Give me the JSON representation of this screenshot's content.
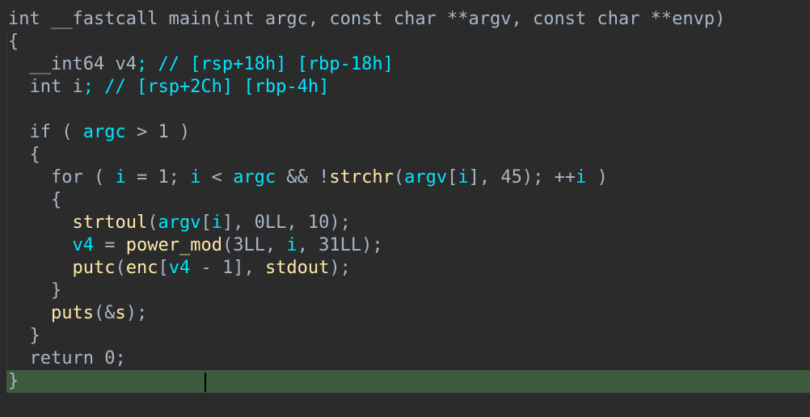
{
  "colors": {
    "background": "#2b2b2b",
    "current_line_highlight": "#3e5b3d",
    "default_text": "#a9b7c6",
    "variable": "#00e5ff",
    "function": "#ffe9a6"
  },
  "current_line": 16,
  "lines": [
    [
      {
        "t": "int __fastcall main(int argc, const char **argv, const char **envp)",
        "c": "pl"
      }
    ],
    [
      {
        "t": "{",
        "c": "pl"
      }
    ],
    [
      {
        "t": "  __int64 ",
        "c": "kw"
      },
      {
        "t": "v4",
        "c": "kw"
      },
      {
        "t": "; // [rsp+18h] [rbp-18h]",
        "c": "var"
      }
    ],
    [
      {
        "t": "  int ",
        "c": "kw"
      },
      {
        "t": "i",
        "c": "kw"
      },
      {
        "t": "; // [rsp+2Ch] [rbp-4h]",
        "c": "var"
      }
    ],
    [
      {
        "t": "",
        "c": "pl"
      }
    ],
    [
      {
        "t": "  if ( ",
        "c": "kw"
      },
      {
        "t": "argc",
        "c": "var"
      },
      {
        "t": " > 1 )",
        "c": "pl"
      }
    ],
    [
      {
        "t": "  {",
        "c": "pl"
      }
    ],
    [
      {
        "t": "    for ( ",
        "c": "kw"
      },
      {
        "t": "i",
        "c": "var"
      },
      {
        "t": " = 1; ",
        "c": "pl"
      },
      {
        "t": "i",
        "c": "var"
      },
      {
        "t": " < ",
        "c": "pl"
      },
      {
        "t": "argc",
        "c": "var"
      },
      {
        "t": " && !",
        "c": "pl"
      },
      {
        "t": "strchr",
        "c": "fn"
      },
      {
        "t": "(",
        "c": "pl"
      },
      {
        "t": "argv",
        "c": "var"
      },
      {
        "t": "[",
        "c": "pl"
      },
      {
        "t": "i",
        "c": "var"
      },
      {
        "t": "], 45); ++",
        "c": "pl"
      },
      {
        "t": "i",
        "c": "var"
      },
      {
        "t": " )",
        "c": "pl"
      }
    ],
    [
      {
        "t": "    {",
        "c": "pl"
      }
    ],
    [
      {
        "t": "      ",
        "c": "pl"
      },
      {
        "t": "strtoul",
        "c": "fn"
      },
      {
        "t": "(",
        "c": "pl"
      },
      {
        "t": "argv",
        "c": "var"
      },
      {
        "t": "[",
        "c": "pl"
      },
      {
        "t": "i",
        "c": "var"
      },
      {
        "t": "], 0LL, 10);",
        "c": "pl"
      }
    ],
    [
      {
        "t": "      ",
        "c": "pl"
      },
      {
        "t": "v4",
        "c": "var"
      },
      {
        "t": " = ",
        "c": "pl"
      },
      {
        "t": "power_mod",
        "c": "fn"
      },
      {
        "t": "(3LL, ",
        "c": "pl"
      },
      {
        "t": "i",
        "c": "var"
      },
      {
        "t": ", 31LL);",
        "c": "pl"
      }
    ],
    [
      {
        "t": "      ",
        "c": "pl"
      },
      {
        "t": "putc",
        "c": "fn"
      },
      {
        "t": "(",
        "c": "pl"
      },
      {
        "t": "enc",
        "c": "fn"
      },
      {
        "t": "[",
        "c": "pl"
      },
      {
        "t": "v4",
        "c": "var"
      },
      {
        "t": " - 1], ",
        "c": "pl"
      },
      {
        "t": "stdout",
        "c": "fn"
      },
      {
        "t": ");",
        "c": "pl"
      }
    ],
    [
      {
        "t": "    }",
        "c": "pl"
      }
    ],
    [
      {
        "t": "    ",
        "c": "pl"
      },
      {
        "t": "puts",
        "c": "fn"
      },
      {
        "t": "(&",
        "c": "pl"
      },
      {
        "t": "s",
        "c": "fn"
      },
      {
        "t": ");",
        "c": "pl"
      }
    ],
    [
      {
        "t": "  }",
        "c": "pl"
      }
    ],
    [
      {
        "t": "  return 0;",
        "c": "pl"
      }
    ],
    [
      {
        "t": "}",
        "c": "pl"
      }
    ]
  ]
}
